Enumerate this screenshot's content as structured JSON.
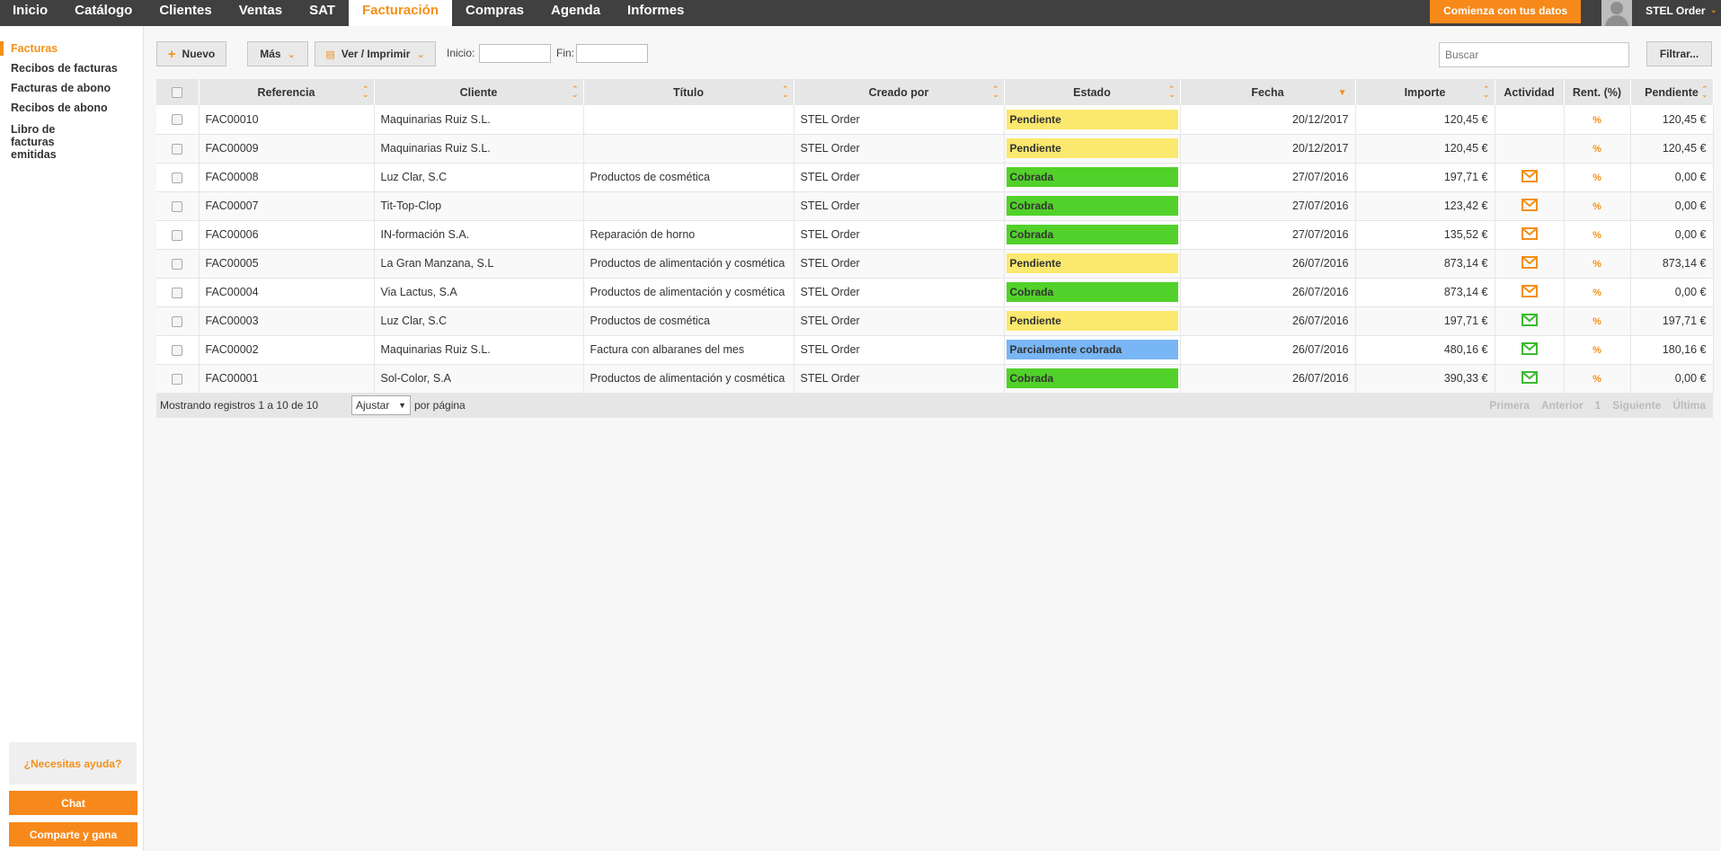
{
  "nav": {
    "items": [
      "Inicio",
      "Catálogo",
      "Clientes",
      "Ventas",
      "SAT",
      "Facturación",
      "Compras",
      "Agenda",
      "Informes"
    ],
    "active": "Facturación",
    "start_button": "Comienza con tus datos",
    "user": "STEL Order"
  },
  "sidebar": {
    "items": [
      "Facturas",
      "Recibos de facturas",
      "Facturas de abono",
      "Recibos de abono",
      "Libro de facturas emitidas"
    ],
    "active": "Facturas",
    "help": "¿Necesitas ayuda?",
    "chat": "Chat",
    "share": "Comparte y gana"
  },
  "toolbar": {
    "new_label": "Nuevo",
    "more_label": "Más",
    "print_label": "Ver / Imprimir",
    "start_label": "Inicio:",
    "end_label": "Fin:",
    "start_value": "",
    "end_value": "",
    "search_placeholder": "Buscar",
    "filter_label": "Filtrar..."
  },
  "table": {
    "columns": [
      "Referencia",
      "Cliente",
      "Título",
      "Creado por",
      "Estado",
      "Fecha",
      "Importe",
      "Actividad",
      "Rent. (%)",
      "Pendiente"
    ],
    "rows": [
      {
        "ref": "FAC00010",
        "cliente": "Maquinarias Ruiz S.L.",
        "titulo": "",
        "creado": "STEL Order",
        "estado": "Pendiente",
        "fecha": "20/12/2017",
        "importe": "120,45 €",
        "actividad": "",
        "rent": "%",
        "pendiente": "120,45 €"
      },
      {
        "ref": "FAC00009",
        "cliente": "Maquinarias Ruiz S.L.",
        "titulo": "",
        "creado": "STEL Order",
        "estado": "Pendiente",
        "fecha": "20/12/2017",
        "importe": "120,45 €",
        "actividad": "",
        "rent": "%",
        "pendiente": "120,45 €"
      },
      {
        "ref": "FAC00008",
        "cliente": "Luz Clar, S.C",
        "titulo": "Productos de cosmética",
        "creado": "STEL Order",
        "estado": "Cobrada",
        "fecha": "27/07/2016",
        "importe": "197,71 €",
        "actividad": "mail-orange",
        "rent": "%",
        "pendiente": "0,00 €"
      },
      {
        "ref": "FAC00007",
        "cliente": "Tit-Top-Clop",
        "titulo": "",
        "creado": "STEL Order",
        "estado": "Cobrada",
        "fecha": "27/07/2016",
        "importe": "123,42 €",
        "actividad": "mail-orange",
        "rent": "%",
        "pendiente": "0,00 €"
      },
      {
        "ref": "FAC00006",
        "cliente": "IN-formación S.A.",
        "titulo": "Reparación de horno",
        "creado": "STEL Order",
        "estado": "Cobrada",
        "fecha": "27/07/2016",
        "importe": "135,52 €",
        "actividad": "mail-orange",
        "rent": "%",
        "pendiente": "0,00 €"
      },
      {
        "ref": "FAC00005",
        "cliente": "La Gran Manzana, S.L",
        "titulo": "Productos de alimentación y cosmética",
        "creado": "STEL Order",
        "estado": "Pendiente",
        "fecha": "26/07/2016",
        "importe": "873,14 €",
        "actividad": "mail-orange",
        "rent": "%",
        "pendiente": "873,14 €"
      },
      {
        "ref": "FAC00004",
        "cliente": "Via Lactus, S.A",
        "titulo": "Productos de alimentación y cosmética",
        "creado": "STEL Order",
        "estado": "Cobrada",
        "fecha": "26/07/2016",
        "importe": "873,14 €",
        "actividad": "mail-orange",
        "rent": "%",
        "pendiente": "0,00 €"
      },
      {
        "ref": "FAC00003",
        "cliente": "Luz Clar, S.C",
        "titulo": "Productos de cosmética",
        "creado": "STEL Order",
        "estado": "Pendiente",
        "fecha": "26/07/2016",
        "importe": "197,71 €",
        "actividad": "mail-green",
        "rent": "%",
        "pendiente": "197,71 €"
      },
      {
        "ref": "FAC00002",
        "cliente": "Maquinarias Ruiz S.L.",
        "titulo": "Factura con albaranes del mes",
        "creado": "STEL Order",
        "estado": "Parcialmente cobrada",
        "fecha": "26/07/2016",
        "importe": "480,16 €",
        "actividad": "mail-green",
        "rent": "%",
        "pendiente": "180,16 €"
      },
      {
        "ref": "FAC00001",
        "cliente": "Sol-Color, S.A",
        "titulo": "Productos de alimentación y cosmética",
        "creado": "STEL Order",
        "estado": "Cobrada",
        "fecha": "26/07/2016",
        "importe": "390,33 €",
        "actividad": "mail-green",
        "rent": "%",
        "pendiente": "0,00 €"
      }
    ]
  },
  "status_colors": {
    "Pendiente": "#fbe86e",
    "Cobrada": "#52d12a",
    "Parcialmente cobrada": "#79b6f5"
  },
  "icon_colors": {
    "mail-orange": "#f39019",
    "mail-green": "#3cb932"
  },
  "footer": {
    "showing": "Mostrando registros 1 a 10 de 10",
    "page_size": "Ajustar",
    "per_page": "por página",
    "pager": [
      "Primera",
      "Anterior",
      "1",
      "Siguiente",
      "Última"
    ]
  }
}
